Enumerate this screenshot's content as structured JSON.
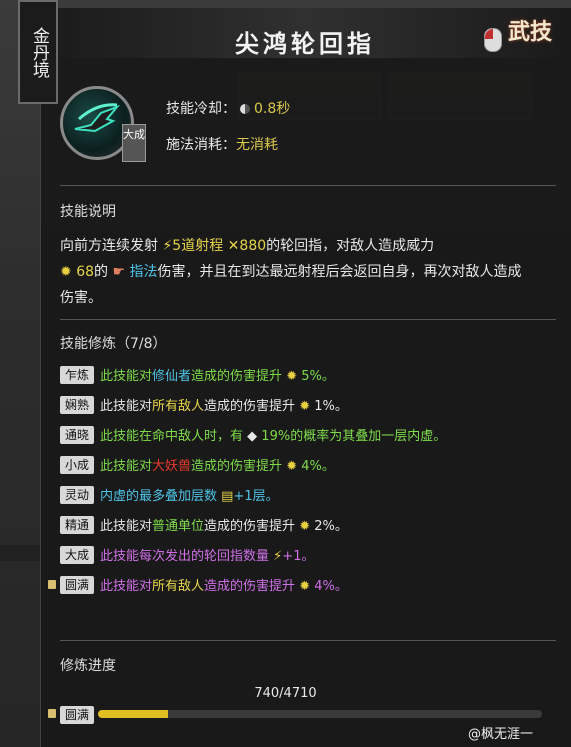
{
  "realm": "金丹境",
  "title": "尖鸿轮回指",
  "badge_corner": "武技",
  "skill_grade": "大成",
  "stats": {
    "cooldown_label": "技能冷却：",
    "cooldown_value": "0.8秒",
    "cost_label": "施法消耗：",
    "cost_value": "无消耗"
  },
  "description": {
    "heading": "技能说明",
    "t1": "向前方连续发射",
    "n1": "5道射程",
    "n2": "880",
    "t2": "的轮回指，对敌人造成威力",
    "n3": "68",
    "t3": "的",
    "n4": "指法",
    "t4": "伤害，并且在到达最远射程后会返回自身，再次对敌人造成伤害。"
  },
  "mods_heading": "技能修炼（7/8）",
  "mods": [
    {
      "tag": "乍炼",
      "a": "此技能对",
      "b": "修仙者",
      "c": "造成的伤害提升",
      "d": "5%。"
    },
    {
      "tag": "娴熟",
      "a": "此技能对",
      "b": "所有敌人",
      "c": "造成的伤害提升",
      "d": "1%。"
    },
    {
      "tag": "通晓",
      "a": "此技能在命中敌人时，有",
      "b": "19%的概率为其叠加一层内虚。"
    },
    {
      "tag": "小成",
      "a": "此技能对",
      "b": "大妖兽",
      "c": "造成的伤害提升",
      "d": "4%。"
    },
    {
      "tag": "灵动",
      "a": "内虚的最多叠加层数",
      "b": "+1层。"
    },
    {
      "tag": "精通",
      "a": "此技能对",
      "b": "普通单位",
      "c": "造成的伤害提升",
      "d": "2%。"
    },
    {
      "tag": "大成",
      "a": "此技能每次发出的轮回指数量",
      "b": "+1。"
    },
    {
      "tag": "圆满",
      "a": "此技能对",
      "b": "所有敌人",
      "c": "造成的伤害提升",
      "d": "4%。"
    }
  ],
  "progress": {
    "heading": "修炼进度",
    "value_text": "740/4710",
    "fraction": 0.157,
    "tag": "圆满"
  },
  "watermark": "@枫无涯一",
  "colors": {
    "yellow": "#e6d44a",
    "green": "#7edc4a",
    "cyan": "#4fc3e6",
    "red": "#e63a2a",
    "purple": "#d070e8"
  }
}
